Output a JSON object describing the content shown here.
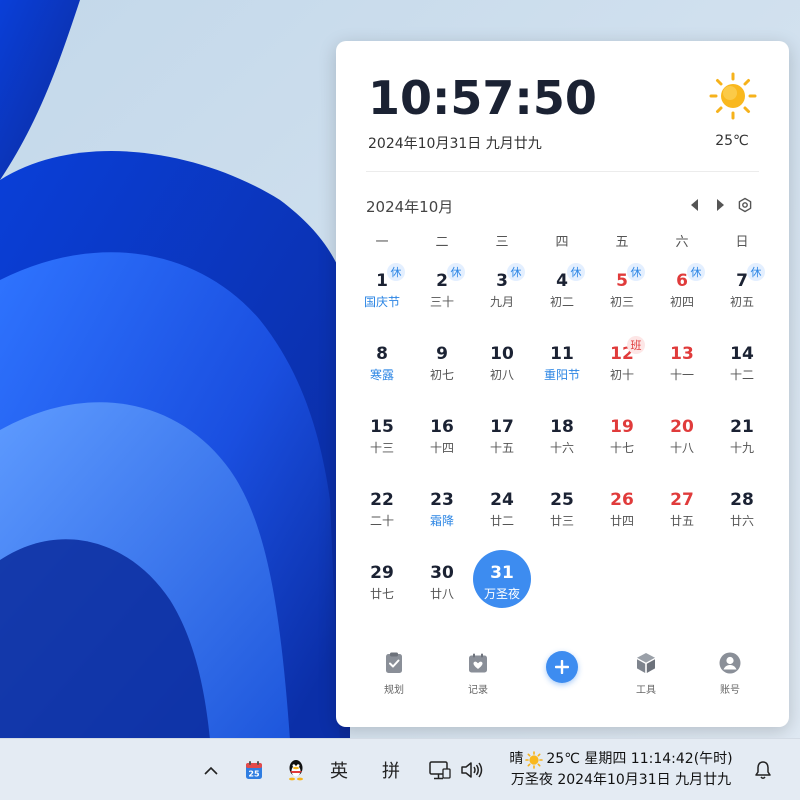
{
  "clock": {
    "time": "10:57:50",
    "date_line": "2024年10月31日 九月廿九"
  },
  "weather": {
    "icon": "sun-icon",
    "temp": "25℃"
  },
  "calendar": {
    "month_title": "2024年10月",
    "weekdays": [
      "一",
      "二",
      "三",
      "四",
      "五",
      "六",
      "日"
    ],
    "leading_blank_days": 0,
    "days": [
      {
        "num": "1",
        "lunar": "国庆节",
        "festival": true,
        "weekend": false,
        "badge": "休",
        "badge_type": "rest"
      },
      {
        "num": "2",
        "lunar": "三十",
        "festival": false,
        "weekend": false,
        "badge": "休",
        "badge_type": "rest"
      },
      {
        "num": "3",
        "lunar": "九月",
        "festival": false,
        "weekend": false,
        "badge": "休",
        "badge_type": "rest"
      },
      {
        "num": "4",
        "lunar": "初二",
        "festival": false,
        "weekend": false,
        "badge": "休",
        "badge_type": "rest"
      },
      {
        "num": "5",
        "lunar": "初三",
        "festival": false,
        "weekend": true,
        "badge": "休",
        "badge_type": "rest"
      },
      {
        "num": "6",
        "lunar": "初四",
        "festival": false,
        "weekend": true,
        "badge": "休",
        "badge_type": "rest"
      },
      {
        "num": "7",
        "lunar": "初五",
        "festival": false,
        "weekend": false,
        "badge": "休",
        "badge_type": "rest"
      },
      {
        "num": "8",
        "lunar": "寒露",
        "festival": true,
        "weekend": false
      },
      {
        "num": "9",
        "lunar": "初七",
        "festival": false,
        "weekend": false
      },
      {
        "num": "10",
        "lunar": "初八",
        "festival": false,
        "weekend": false
      },
      {
        "num": "11",
        "lunar": "重阳节",
        "festival": true,
        "weekend": false
      },
      {
        "num": "12",
        "lunar": "初十",
        "festival": false,
        "weekend": true,
        "badge": "班",
        "badge_type": "work"
      },
      {
        "num": "13",
        "lunar": "十一",
        "festival": false,
        "weekend": true
      },
      {
        "num": "14",
        "lunar": "十二",
        "festival": false,
        "weekend": false
      },
      {
        "num": "15",
        "lunar": "十三",
        "festival": false,
        "weekend": false
      },
      {
        "num": "16",
        "lunar": "十四",
        "festival": false,
        "weekend": false
      },
      {
        "num": "17",
        "lunar": "十五",
        "festival": false,
        "weekend": false
      },
      {
        "num": "18",
        "lunar": "十六",
        "festival": false,
        "weekend": false
      },
      {
        "num": "19",
        "lunar": "十七",
        "festival": false,
        "weekend": true
      },
      {
        "num": "20",
        "lunar": "十八",
        "festival": false,
        "weekend": true
      },
      {
        "num": "21",
        "lunar": "十九",
        "festival": false,
        "weekend": false
      },
      {
        "num": "22",
        "lunar": "二十",
        "festival": false,
        "weekend": false
      },
      {
        "num": "23",
        "lunar": "霜降",
        "festival": true,
        "weekend": false
      },
      {
        "num": "24",
        "lunar": "廿二",
        "festival": false,
        "weekend": false
      },
      {
        "num": "25",
        "lunar": "廿三",
        "festival": false,
        "weekend": false
      },
      {
        "num": "26",
        "lunar": "廿四",
        "festival": false,
        "weekend": true
      },
      {
        "num": "27",
        "lunar": "廿五",
        "festival": false,
        "weekend": true
      },
      {
        "num": "28",
        "lunar": "廿六",
        "festival": false,
        "weekend": false
      },
      {
        "num": "29",
        "lunar": "廿七",
        "festival": false,
        "weekend": false
      },
      {
        "num": "30",
        "lunar": "廿八",
        "festival": false,
        "weekend": false
      },
      {
        "num": "31",
        "lunar": "万圣夜",
        "festival": false,
        "weekend": false,
        "today": true
      }
    ]
  },
  "toolbar": {
    "items": [
      {
        "label": "规划",
        "icon": "clipboard-check-icon"
      },
      {
        "label": "",
        "icon": "plus-icon"
      },
      {
        "label": "记录",
        "icon": "calendar-heart-icon"
      },
      {
        "label": "工具",
        "icon": "cube-icon"
      },
      {
        "label": "账号",
        "icon": "user-icon"
      }
    ]
  },
  "taskbar": {
    "chevron": "∧",
    "calendar_badge": "25",
    "lang": "英",
    "ime": "拼",
    "clock_line1_prefix": "晴",
    "clock_line1_rest": "25℃ 星期四 11:14:42(午时)",
    "clock_line2": "万圣夜 2024年10月31日 九月廿九"
  },
  "colors": {
    "accent": "#3d8cf0",
    "weekend": "#e03b3b",
    "festival": "#2b85e4"
  }
}
